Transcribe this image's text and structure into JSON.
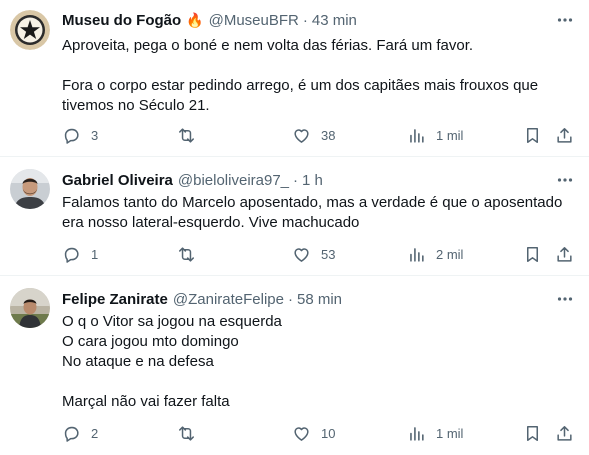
{
  "tweets": [
    {
      "name": "Museu do Fogão",
      "emoji": "🔥",
      "handle": "@MuseuBFR",
      "time": "43 min",
      "lines": [
        "Aproveita, pega o boné e nem volta das férias. Fará um favor.",
        "",
        "Fora o corpo estar pedindo arrego, é um dos capitães mais frouxos que",
        "tivemos no Século 21."
      ],
      "replies": "3",
      "retweets": "",
      "likes": "38",
      "views": "1 mil"
    },
    {
      "name": "Gabriel Oliveira",
      "handle": "@bieloliveira97_",
      "time": "1 h",
      "lines": [
        "Falamos tanto do Marcelo aposentado, mas a verdade é que o aposentado",
        "era nosso lateral-esquerdo. Vive machucado"
      ],
      "replies": "1",
      "retweets": "",
      "likes": "53",
      "views": "2 mil"
    },
    {
      "name": "Felipe Zanirate",
      "handle": "@ZanirateFelipe",
      "time": "58 min",
      "lines": [
        "O q o Vitor sa jogou na esquerda",
        "O cara jogou mto domingo",
        "No ataque e na defesa",
        "",
        "Marçal não vai fazer falta"
      ],
      "replies": "2",
      "retweets": "",
      "likes": "10",
      "views": "1 mil"
    }
  ],
  "separator": "·",
  "colors": {
    "text": "#0f1419",
    "secondary": "#536471",
    "divider": "#eff3f4",
    "accent": "#f4a63b"
  },
  "icons": [
    "more-icon",
    "reply-icon",
    "retweet-icon",
    "like-icon",
    "views-icon",
    "bookmark-icon",
    "share-icon"
  ]
}
